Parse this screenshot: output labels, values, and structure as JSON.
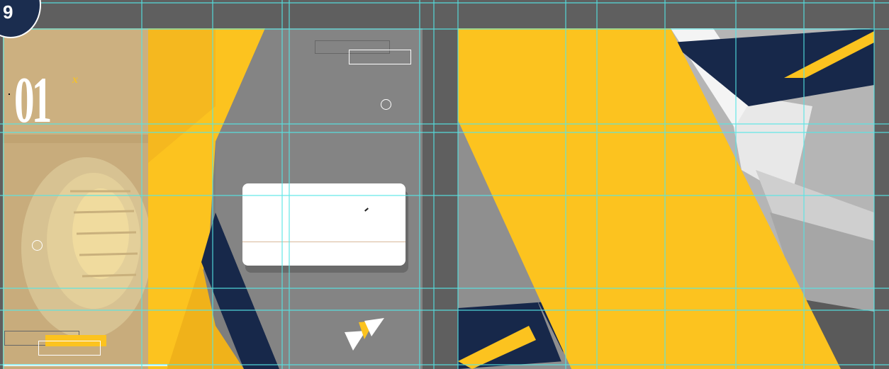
{
  "document": {
    "page_number": "01",
    "page_number_mark": "x"
  },
  "tab_badge": {
    "glyph": "9"
  },
  "colors": {
    "accent_yellow": "#fcc31f",
    "navy": "#17284a",
    "guide_cyan": "#55e6e6",
    "photo_tan": "#c8ac7c",
    "canvas_gray": "#5f5f5f"
  },
  "icons": [
    "double-arrow-icon",
    "circle-marker-icon"
  ]
}
